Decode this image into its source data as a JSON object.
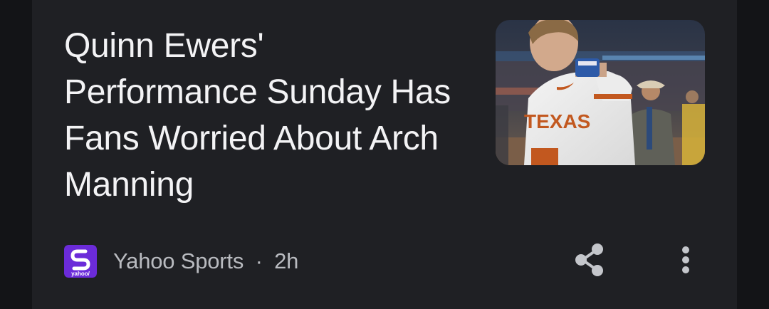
{
  "article": {
    "headline": "Quinn Ewers' Performance Sunday Has Fans Worried About Arch Manning",
    "source_name": "Yahoo Sports",
    "separator": "·",
    "time_ago": "2h",
    "source_logo_text": "yahoo/",
    "image_jersey_text": "TEXAS"
  },
  "icons": {
    "source_logo": "yahoo-sports-logo-icon",
    "share": "share-icon",
    "more": "more-vertical-icon"
  },
  "colors": {
    "background": "#131417",
    "card": "#1f2024",
    "headline_text": "#f3f3f5",
    "meta_text": "#b9bbc0",
    "icon": "#c4c6cb",
    "yahoo_purple": "#6b2bd9"
  }
}
